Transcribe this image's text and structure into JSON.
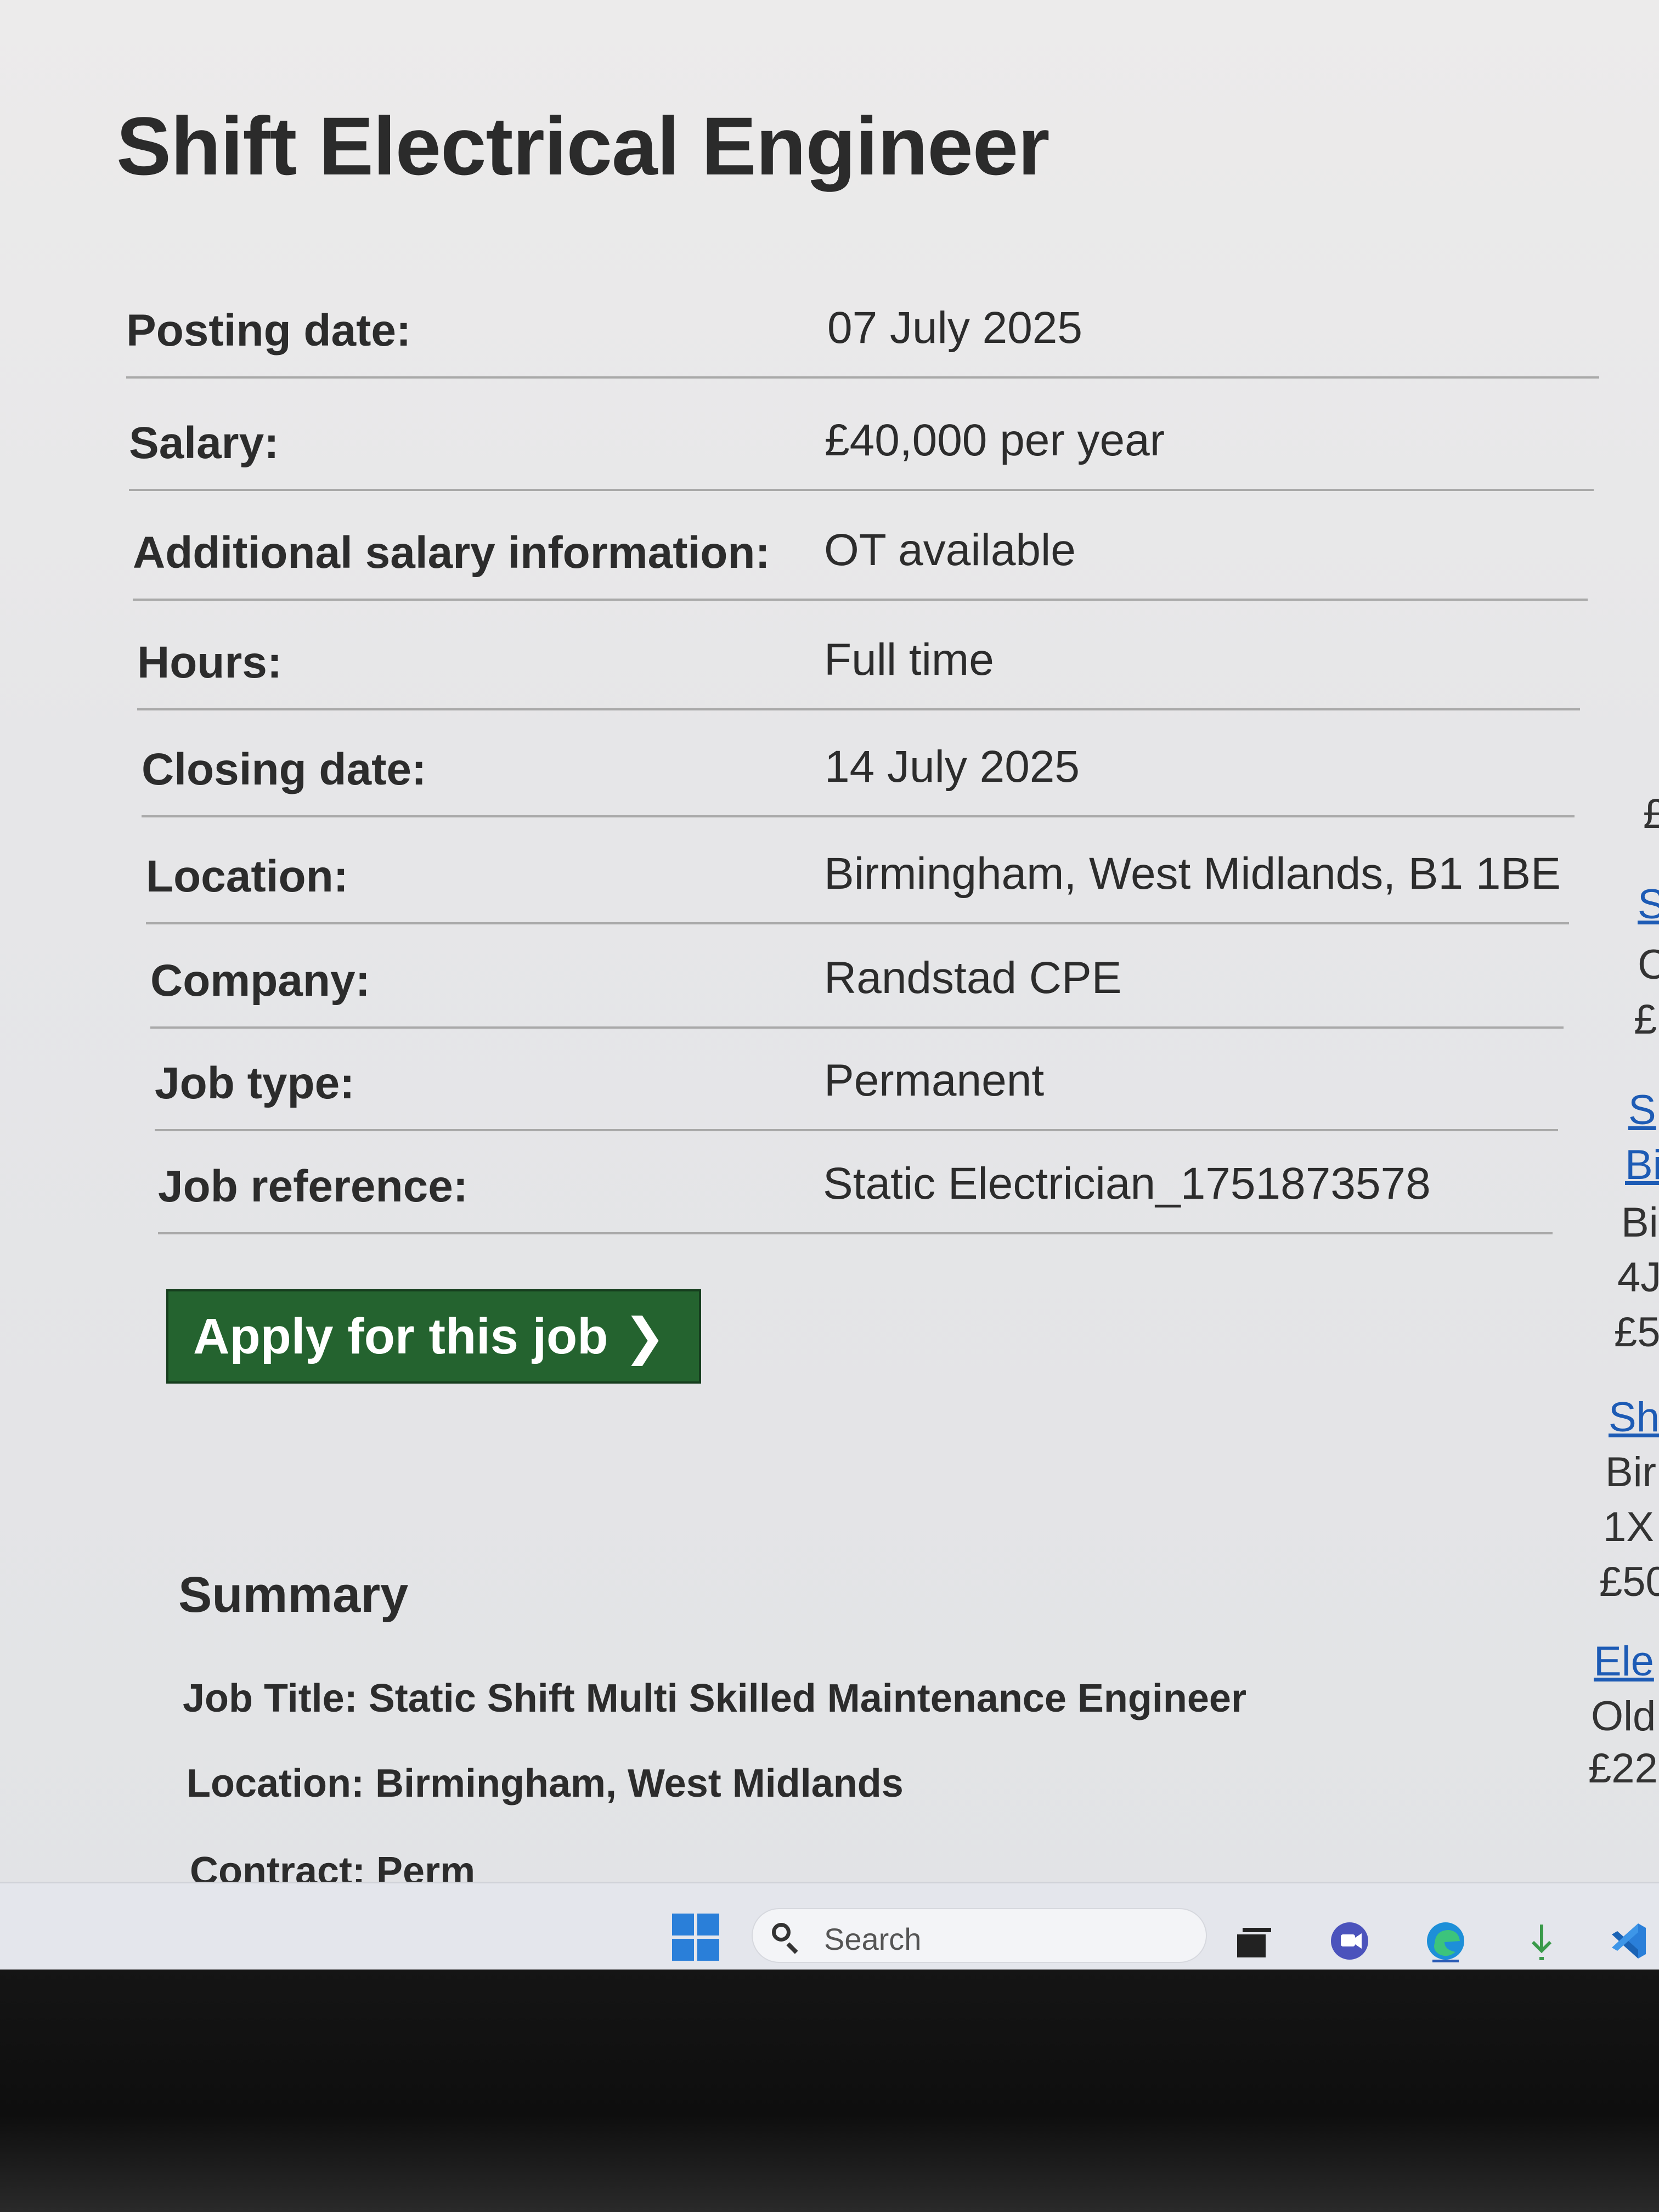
{
  "job": {
    "title": "Shift Electrical Engineer",
    "details": [
      {
        "label": "Posting date:",
        "value": "07 July 2025"
      },
      {
        "label": "Salary:",
        "value": "£40,000 per year"
      },
      {
        "label": "Additional salary information:",
        "value": "OT available"
      },
      {
        "label": "Hours:",
        "value": "Full time"
      },
      {
        "label": "Closing date:",
        "value": "14 July 2025"
      },
      {
        "label": "Location:",
        "value": "Birmingham, West Midlands, B1 1BE"
      },
      {
        "label": "Company:",
        "value": "Randstad CPE"
      },
      {
        "label": "Job type:",
        "value": "Permanent"
      },
      {
        "label": "Job reference:",
        "value": "Static Electrician_1751873578"
      }
    ],
    "apply_label": "Apply for this job",
    "apply_chevron": "❯"
  },
  "summary": {
    "heading": "Summary",
    "lines": [
      "Job Title: Static Shift Multi Skilled Maintenance Engineer",
      "Location: Birmingham, West Midlands",
      "Contract: Perm"
    ]
  },
  "sidebar_fragments": [
    {
      "text": "£",
      "link": false
    },
    {
      "text": "S",
      "link": true
    },
    {
      "text": "C",
      "link": false
    },
    {
      "text": "£",
      "link": false
    },
    {
      "text": "S",
      "link": true
    },
    {
      "text": "Bi",
      "link": true
    },
    {
      "text": "Bi",
      "link": false
    },
    {
      "text": "4J",
      "link": false
    },
    {
      "text": "£5",
      "link": false
    },
    {
      "text": "Sh",
      "link": true
    },
    {
      "text": "Bir",
      "link": false
    },
    {
      "text": "1X",
      "link": false
    },
    {
      "text": "£50",
      "link": false
    },
    {
      "text": "Ele",
      "link": true
    },
    {
      "text": "Old",
      "link": false
    },
    {
      "text": "£22",
      "link": false
    }
  ],
  "taskbar": {
    "search_placeholder": "Search",
    "icons": [
      "windows-start-icon",
      "search-icon",
      "task-view-icon",
      "chat-icon",
      "edge-browser-icon",
      "download-icon",
      "vscode-icon"
    ]
  },
  "colors": {
    "apply_button": "#24632f",
    "link": "#1d5bb5",
    "text": "#2c2c2c",
    "divider": "#a9a9a9"
  }
}
